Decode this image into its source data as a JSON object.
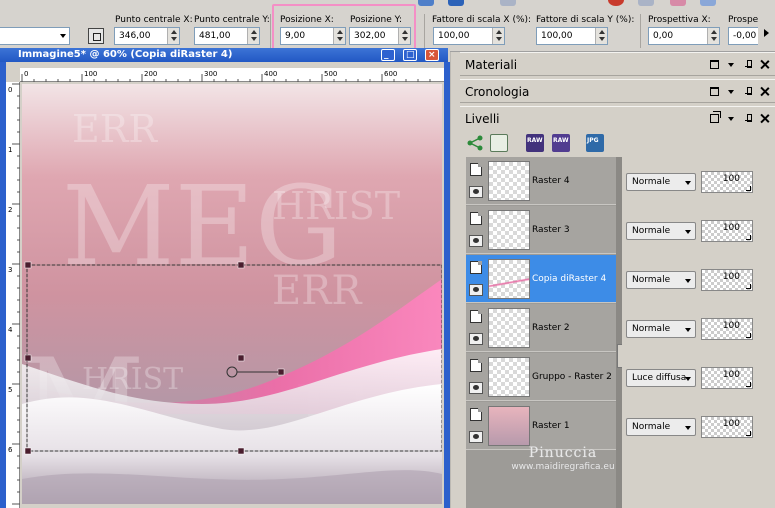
{
  "toolbar": {
    "center_x_label": "Punto centrale X:",
    "center_x_value": "346,00",
    "center_y_label": "Punto centrale Y:",
    "center_y_value": "481,00",
    "pos_x_label": "Posizione X:",
    "pos_x_value": "9,00",
    "pos_y_label": "Posizione Y:",
    "pos_y_value": "302,00",
    "scale_x_label": "Fattore di scala X (%):",
    "scale_x_value": "100,00",
    "scale_y_label": "Fattore di scala Y (%):",
    "scale_y_value": "100,00",
    "persp_x_label": "Prospettiva X:",
    "persp_x_value": "0,00",
    "persp_y_label": "Prospe",
    "persp_y_value": "-0,00",
    "highlight_color": "#f48fc6"
  },
  "image_window": {
    "title": "Immagine5* @ 60% (Copia diRaster 4)",
    "canvas_text": {
      "t1": "ERR",
      "t2": "MEG",
      "t3": "HRIST",
      "t4": "ERR",
      "t5": "HRIST",
      "t6": "M",
      "t7": "E"
    },
    "ruler_h": [
      "0",
      "100",
      "200",
      "300",
      "400",
      "500",
      "600"
    ],
    "ruler_v": [
      "0",
      "1",
      "2",
      "3",
      "4",
      "5",
      "6"
    ]
  },
  "panels": {
    "materiali": "Materiali",
    "cronologia": "Cronologia",
    "livelli": "Livelli"
  },
  "layer_tools": [
    {
      "icon": "share-icon"
    },
    {
      "icon": "layer-mask-icon"
    },
    {
      "icon": "raw-jpg-icon",
      "label": "RAW"
    },
    {
      "icon": "raw-icon",
      "label": "RAW"
    },
    {
      "icon": "jpg-icon",
      "label": "JPG"
    }
  ],
  "layers": [
    {
      "name": "Raster 4",
      "blend": "Normale",
      "opacity": "100",
      "selected": false
    },
    {
      "name": "Raster 3",
      "blend": "Normale",
      "opacity": "100",
      "selected": false
    },
    {
      "name": "Copia diRaster 4",
      "blend": "Normale",
      "opacity": "100",
      "selected": true
    },
    {
      "name": "Raster 2",
      "blend": "Normale",
      "opacity": "100",
      "selected": false
    },
    {
      "name": "Gruppo - Raster 2",
      "blend": "Luce diffusa",
      "opacity": "100",
      "selected": false
    },
    {
      "name": "Raster 1",
      "blend": "Normale",
      "opacity": "100",
      "selected": false
    }
  ],
  "watermark": {
    "name": "Pinuccia",
    "site": "www.maidiregrafica.eu"
  }
}
